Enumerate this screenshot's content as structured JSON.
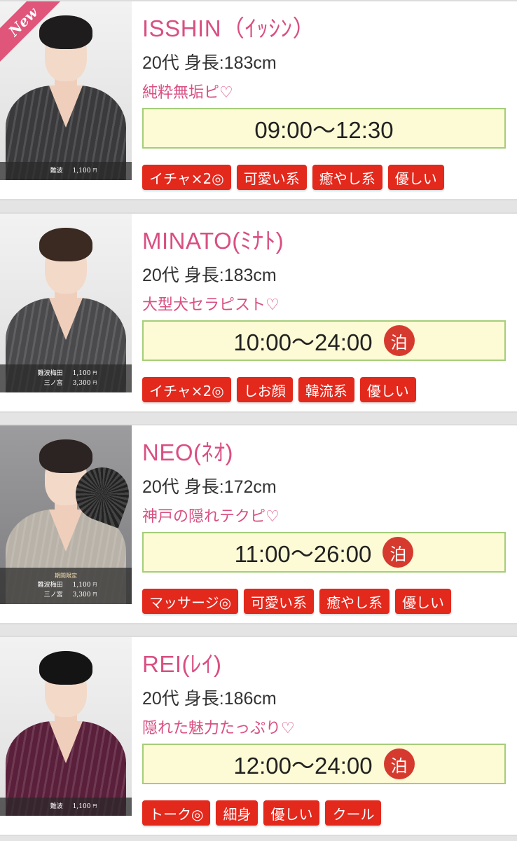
{
  "cards": [
    {
      "name": "ISSHIN（ｲｯｼﾝ）",
      "stats": "20代 身長:183cm",
      "catchphrase": "純粋無垢ピ♡",
      "hours": "09:00〜12:30",
      "overnight": false,
      "new_badge": "New",
      "tags": [
        "イチャ×2◎",
        "可愛い系",
        "癒やし系",
        "優しい"
      ],
      "limited": "",
      "prices": [
        {
          "area": "難波",
          "price": "1,100",
          "unit": "円"
        }
      ],
      "robe_color": "#3a3a3c",
      "hair_color": "#1e1c1c"
    },
    {
      "name": "MINATO(ﾐﾅﾄ)",
      "stats": "20代 身長:183cm",
      "catchphrase": "大型犬セラピスト♡",
      "hours": "10:00〜24:00",
      "overnight": true,
      "overnight_label": "泊",
      "new_badge": "",
      "tags": [
        "イチャ×2◎",
        "しお顔",
        "韓流系",
        "優しい"
      ],
      "limited": "",
      "prices": [
        {
          "area": "難波梅田",
          "price": "1,100",
          "unit": "円"
        },
        {
          "area": "三ノ宮",
          "price": "3,300",
          "unit": "円"
        }
      ],
      "robe_color": "#4a4a4c",
      "hair_color": "#3b2a22"
    },
    {
      "name": "NEO(ﾈｵ)",
      "stats": "20代 身長:172cm",
      "catchphrase": "神戸の隠れテクピ♡",
      "hours": "11:00〜26:00",
      "overnight": true,
      "overnight_label": "泊",
      "new_badge": "",
      "tags": [
        "マッサージ◎",
        "可愛い系",
        "癒やし系",
        "優しい"
      ],
      "limited": "期間限定",
      "prices": [
        {
          "area": "難波梅田",
          "price": "1,100",
          "unit": "円"
        },
        {
          "area": "三ノ宮",
          "price": "3,300",
          "unit": "円"
        }
      ],
      "robe_color": "#b8b2a8",
      "hair_color": "#2c2422"
    },
    {
      "name": "REI(ﾚｲ)",
      "stats": "20代 身長:186cm",
      "catchphrase": "隠れた魅力たっぷり♡",
      "hours": "12:00〜24:00",
      "overnight": true,
      "overnight_label": "泊",
      "new_badge": "",
      "tags": [
        "トーク◎",
        "細身",
        "優しい",
        "クール"
      ],
      "limited": "",
      "prices": [
        {
          "area": "難波",
          "price": "1,100",
          "unit": "円"
        }
      ],
      "robe_color": "#5a1f3a",
      "hair_color": "#141414"
    }
  ]
}
